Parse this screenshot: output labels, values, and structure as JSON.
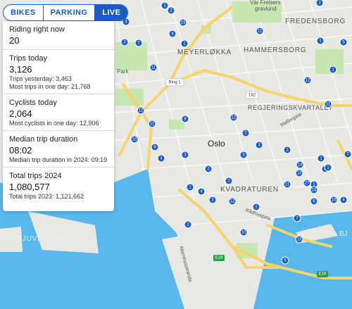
{
  "tabs": [
    {
      "label": "BIKES",
      "active": false
    },
    {
      "label": "PARKING",
      "active": false
    },
    {
      "label": "LIVE",
      "active": true
    }
  ],
  "stats": {
    "riding_now": {
      "label": "Riding right now",
      "value": "20"
    },
    "trips_today": {
      "label": "Trips today",
      "value": "3,126",
      "sub1": "Trips yesterday: 3,463",
      "sub2": "Most trips in one day: 21,768"
    },
    "cyclists_today": {
      "label": "Cyclists today",
      "value": "2,064",
      "sub1": "Most cyclists in one day: 12,906"
    },
    "median_duration": {
      "label": "Median trip duration",
      "value": "08:02",
      "sub1": "Median trip duration in 2024: 09:19"
    },
    "total_trips": {
      "label": "Total trips 2024",
      "value": "1,080,577",
      "sub1": "Total trips 2023: 1,121,662"
    }
  },
  "map": {
    "labels": {
      "var_frelsers": "Vår Frelsers",
      "gravlund": "gravlund",
      "fredensborg": "FREDENSBORG",
      "meyerlokka": "MEYERLØKKA",
      "hammersborg": "HAMMERSBORG",
      "regjeringskvartalet": "REGJERINGSKVARTALET",
      "oslo": "Oslo",
      "kvadraturen": "KVADRATUREN",
      "tjuvholmen": "TJUVHOLMEN",
      "bj": "BJ",
      "park": "Park",
      "ring1": "Ring 1",
      "road162": "162",
      "e18a": "E18",
      "e18b": "E18",
      "mollergata": "Møllergata",
      "radhusgata": "Rådhusgata",
      "akershusstranda": "Akershusstranda"
    },
    "colors": {
      "water": "#58b8ec",
      "land": "#e8e8e4",
      "park": "#c8e6b0",
      "road_major": "#f5d56a",
      "marker": "#1a5bc4"
    },
    "stations": [
      "1",
      "2",
      "2",
      "3",
      "23",
      "11",
      "4",
      "3",
      "1",
      "5",
      "7",
      "1",
      "11",
      "1",
      "12",
      "11",
      "12",
      "8",
      "11",
      "12",
      "10",
      "2",
      "9",
      "3",
      "3",
      "1",
      "3",
      "1",
      "7",
      "4",
      "4",
      "1",
      "2",
      "14",
      "13",
      "27",
      "11",
      "1",
      "4",
      "1",
      "1",
      "24",
      "1",
      "3",
      "12",
      "10",
      "6",
      "4",
      "2",
      "5",
      "13",
      "10",
      "7"
    ]
  }
}
